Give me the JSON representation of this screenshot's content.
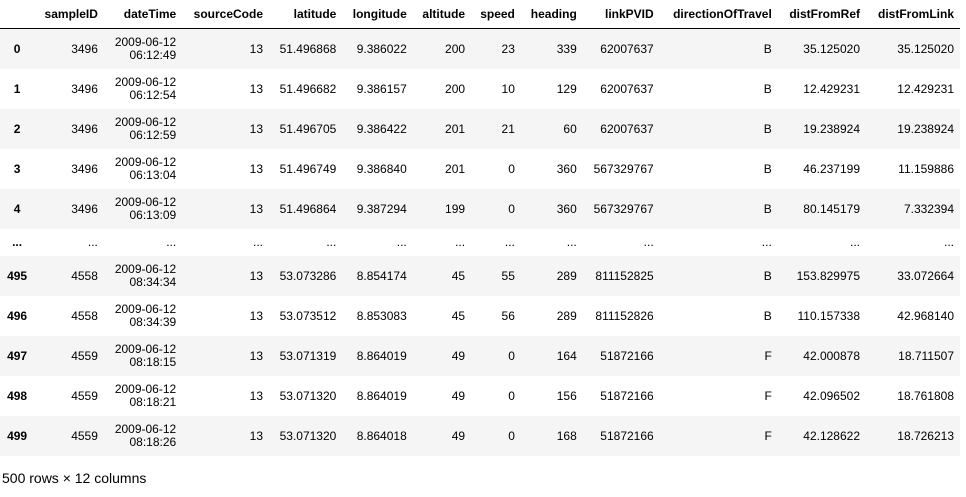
{
  "table": {
    "columns": [
      "sampleID",
      "dateTime",
      "sourceCode",
      "latitude",
      "longitude",
      "altitude",
      "speed",
      "heading",
      "linkPVID",
      "directionOfTravel",
      "distFromRef",
      "distFromLink"
    ],
    "rows": [
      {
        "index": "0",
        "sampleID": "3496",
        "date": "2009-06-12",
        "time": "06:12:49",
        "sourceCode": "13",
        "latitude": "51.496868",
        "longitude": "9.386022",
        "altitude": "200",
        "speed": "23",
        "heading": "339",
        "linkPVID": "62007637",
        "directionOfTravel": "B",
        "distFromRef": "35.125020",
        "distFromLink": "35.125020"
      },
      {
        "index": "1",
        "sampleID": "3496",
        "date": "2009-06-12",
        "time": "06:12:54",
        "sourceCode": "13",
        "latitude": "51.496682",
        "longitude": "9.386157",
        "altitude": "200",
        "speed": "10",
        "heading": "129",
        "linkPVID": "62007637",
        "directionOfTravel": "B",
        "distFromRef": "12.429231",
        "distFromLink": "12.429231"
      },
      {
        "index": "2",
        "sampleID": "3496",
        "date": "2009-06-12",
        "time": "06:12:59",
        "sourceCode": "13",
        "latitude": "51.496705",
        "longitude": "9.386422",
        "altitude": "201",
        "speed": "21",
        "heading": "60",
        "linkPVID": "62007637",
        "directionOfTravel": "B",
        "distFromRef": "19.238924",
        "distFromLink": "19.238924"
      },
      {
        "index": "3",
        "sampleID": "3496",
        "date": "2009-06-12",
        "time": "06:13:04",
        "sourceCode": "13",
        "latitude": "51.496749",
        "longitude": "9.386840",
        "altitude": "201",
        "speed": "0",
        "heading": "360",
        "linkPVID": "567329767",
        "directionOfTravel": "B",
        "distFromRef": "46.237199",
        "distFromLink": "11.159886"
      },
      {
        "index": "4",
        "sampleID": "3496",
        "date": "2009-06-12",
        "time": "06:13:09",
        "sourceCode": "13",
        "latitude": "51.496864",
        "longitude": "9.387294",
        "altitude": "199",
        "speed": "0",
        "heading": "360",
        "linkPVID": "567329767",
        "directionOfTravel": "B",
        "distFromRef": "80.145179",
        "distFromLink": "7.332394"
      },
      {
        "index": "...",
        "sampleID": "...",
        "date": "...",
        "time": "",
        "sourceCode": "...",
        "latitude": "...",
        "longitude": "...",
        "altitude": "...",
        "speed": "...",
        "heading": "...",
        "linkPVID": "...",
        "directionOfTravel": "...",
        "distFromRef": "...",
        "distFromLink": "...",
        "ellipsis": true
      },
      {
        "index": "495",
        "sampleID": "4558",
        "date": "2009-06-12",
        "time": "08:34:34",
        "sourceCode": "13",
        "latitude": "53.073286",
        "longitude": "8.854174",
        "altitude": "45",
        "speed": "55",
        "heading": "289",
        "linkPVID": "811152825",
        "directionOfTravel": "B",
        "distFromRef": "153.829975",
        "distFromLink": "33.072664"
      },
      {
        "index": "496",
        "sampleID": "4558",
        "date": "2009-06-12",
        "time": "08:34:39",
        "sourceCode": "13",
        "latitude": "53.073512",
        "longitude": "8.853083",
        "altitude": "45",
        "speed": "56",
        "heading": "289",
        "linkPVID": "811152826",
        "directionOfTravel": "B",
        "distFromRef": "110.157338",
        "distFromLink": "42.968140"
      },
      {
        "index": "497",
        "sampleID": "4559",
        "date": "2009-06-12",
        "time": "08:18:15",
        "sourceCode": "13",
        "latitude": "53.071319",
        "longitude": "8.864019",
        "altitude": "49",
        "speed": "0",
        "heading": "164",
        "linkPVID": "51872166",
        "directionOfTravel": "F",
        "distFromRef": "42.000878",
        "distFromLink": "18.711507"
      },
      {
        "index": "498",
        "sampleID": "4559",
        "date": "2009-06-12",
        "time": "08:18:21",
        "sourceCode": "13",
        "latitude": "53.071320",
        "longitude": "8.864019",
        "altitude": "49",
        "speed": "0",
        "heading": "156",
        "linkPVID": "51872166",
        "directionOfTravel": "F",
        "distFromRef": "42.096502",
        "distFromLink": "18.761808"
      },
      {
        "index": "499",
        "sampleID": "4559",
        "date": "2009-06-12",
        "time": "08:18:26",
        "sourceCode": "13",
        "latitude": "53.071320",
        "longitude": "8.864018",
        "altitude": "49",
        "speed": "0",
        "heading": "168",
        "linkPVID": "51872166",
        "directionOfTravel": "F",
        "distFromRef": "42.128622",
        "distFromLink": "18.726213"
      }
    ]
  },
  "footer": {
    "summary": "500 rows × 12 columns"
  },
  "colors": {
    "stripe": "#f5f5f5",
    "header_rule": "#000000"
  }
}
